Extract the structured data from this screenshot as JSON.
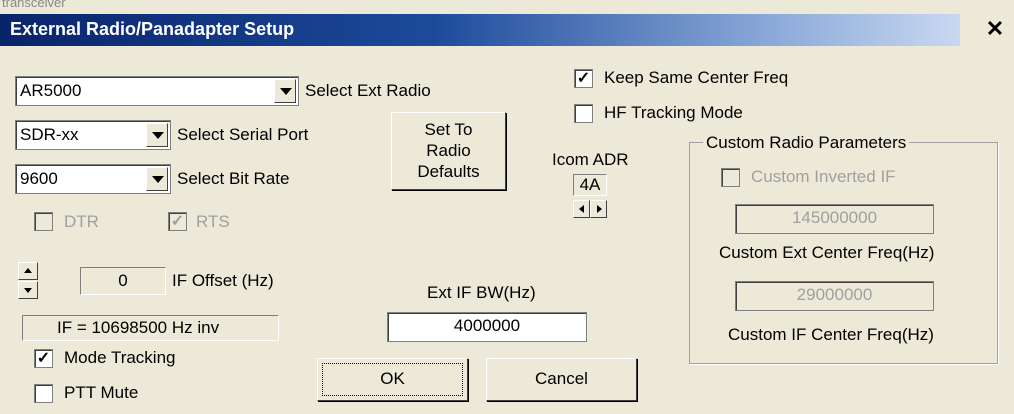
{
  "window": {
    "title": "External Radio/Panadapter Setup",
    "behind_text": "transceiver",
    "close_icon": "close-icon"
  },
  "radio_select": {
    "value": "AR5000",
    "label": "Select Ext Radio"
  },
  "serial_port": {
    "value": "SDR-xx",
    "label": "Select Serial Port"
  },
  "bit_rate": {
    "value": "9600",
    "label": "Select Bit Rate"
  },
  "defaults_button": {
    "line1": "Set To",
    "line2": "Radio",
    "line3": "Defaults"
  },
  "dtr": {
    "label": "DTR",
    "checked": false,
    "enabled": false
  },
  "rts": {
    "label": "RTS",
    "checked": true,
    "enabled": false
  },
  "if_offset": {
    "value": "0",
    "label": "IF Offset (Hz)",
    "readout": "IF = 10698500 Hz inv"
  },
  "mode_tracking": {
    "label": "Mode Tracking",
    "checked": true
  },
  "ptt_mute": {
    "label": "PTT Mute",
    "checked": false
  },
  "keep_center": {
    "label": "Keep Same Center Freq",
    "checked": true
  },
  "hf_tracking": {
    "label": "HF Tracking Mode",
    "checked": false
  },
  "icom_adr": {
    "label": "Icom ADR",
    "value": "4A"
  },
  "ext_if_bw": {
    "label": "Ext IF BW(Hz)",
    "value": "4000000"
  },
  "custom": {
    "group_title": "Custom Radio Parameters",
    "inverted_if_label": "Custom Inverted IF",
    "ext_center_value": "145000000",
    "ext_center_label": "Custom Ext Center Freq(Hz)",
    "if_center_value": "29000000",
    "if_center_label": "Custom IF Center Freq(Hz)"
  },
  "buttons": {
    "ok": "OK",
    "cancel": "Cancel"
  }
}
